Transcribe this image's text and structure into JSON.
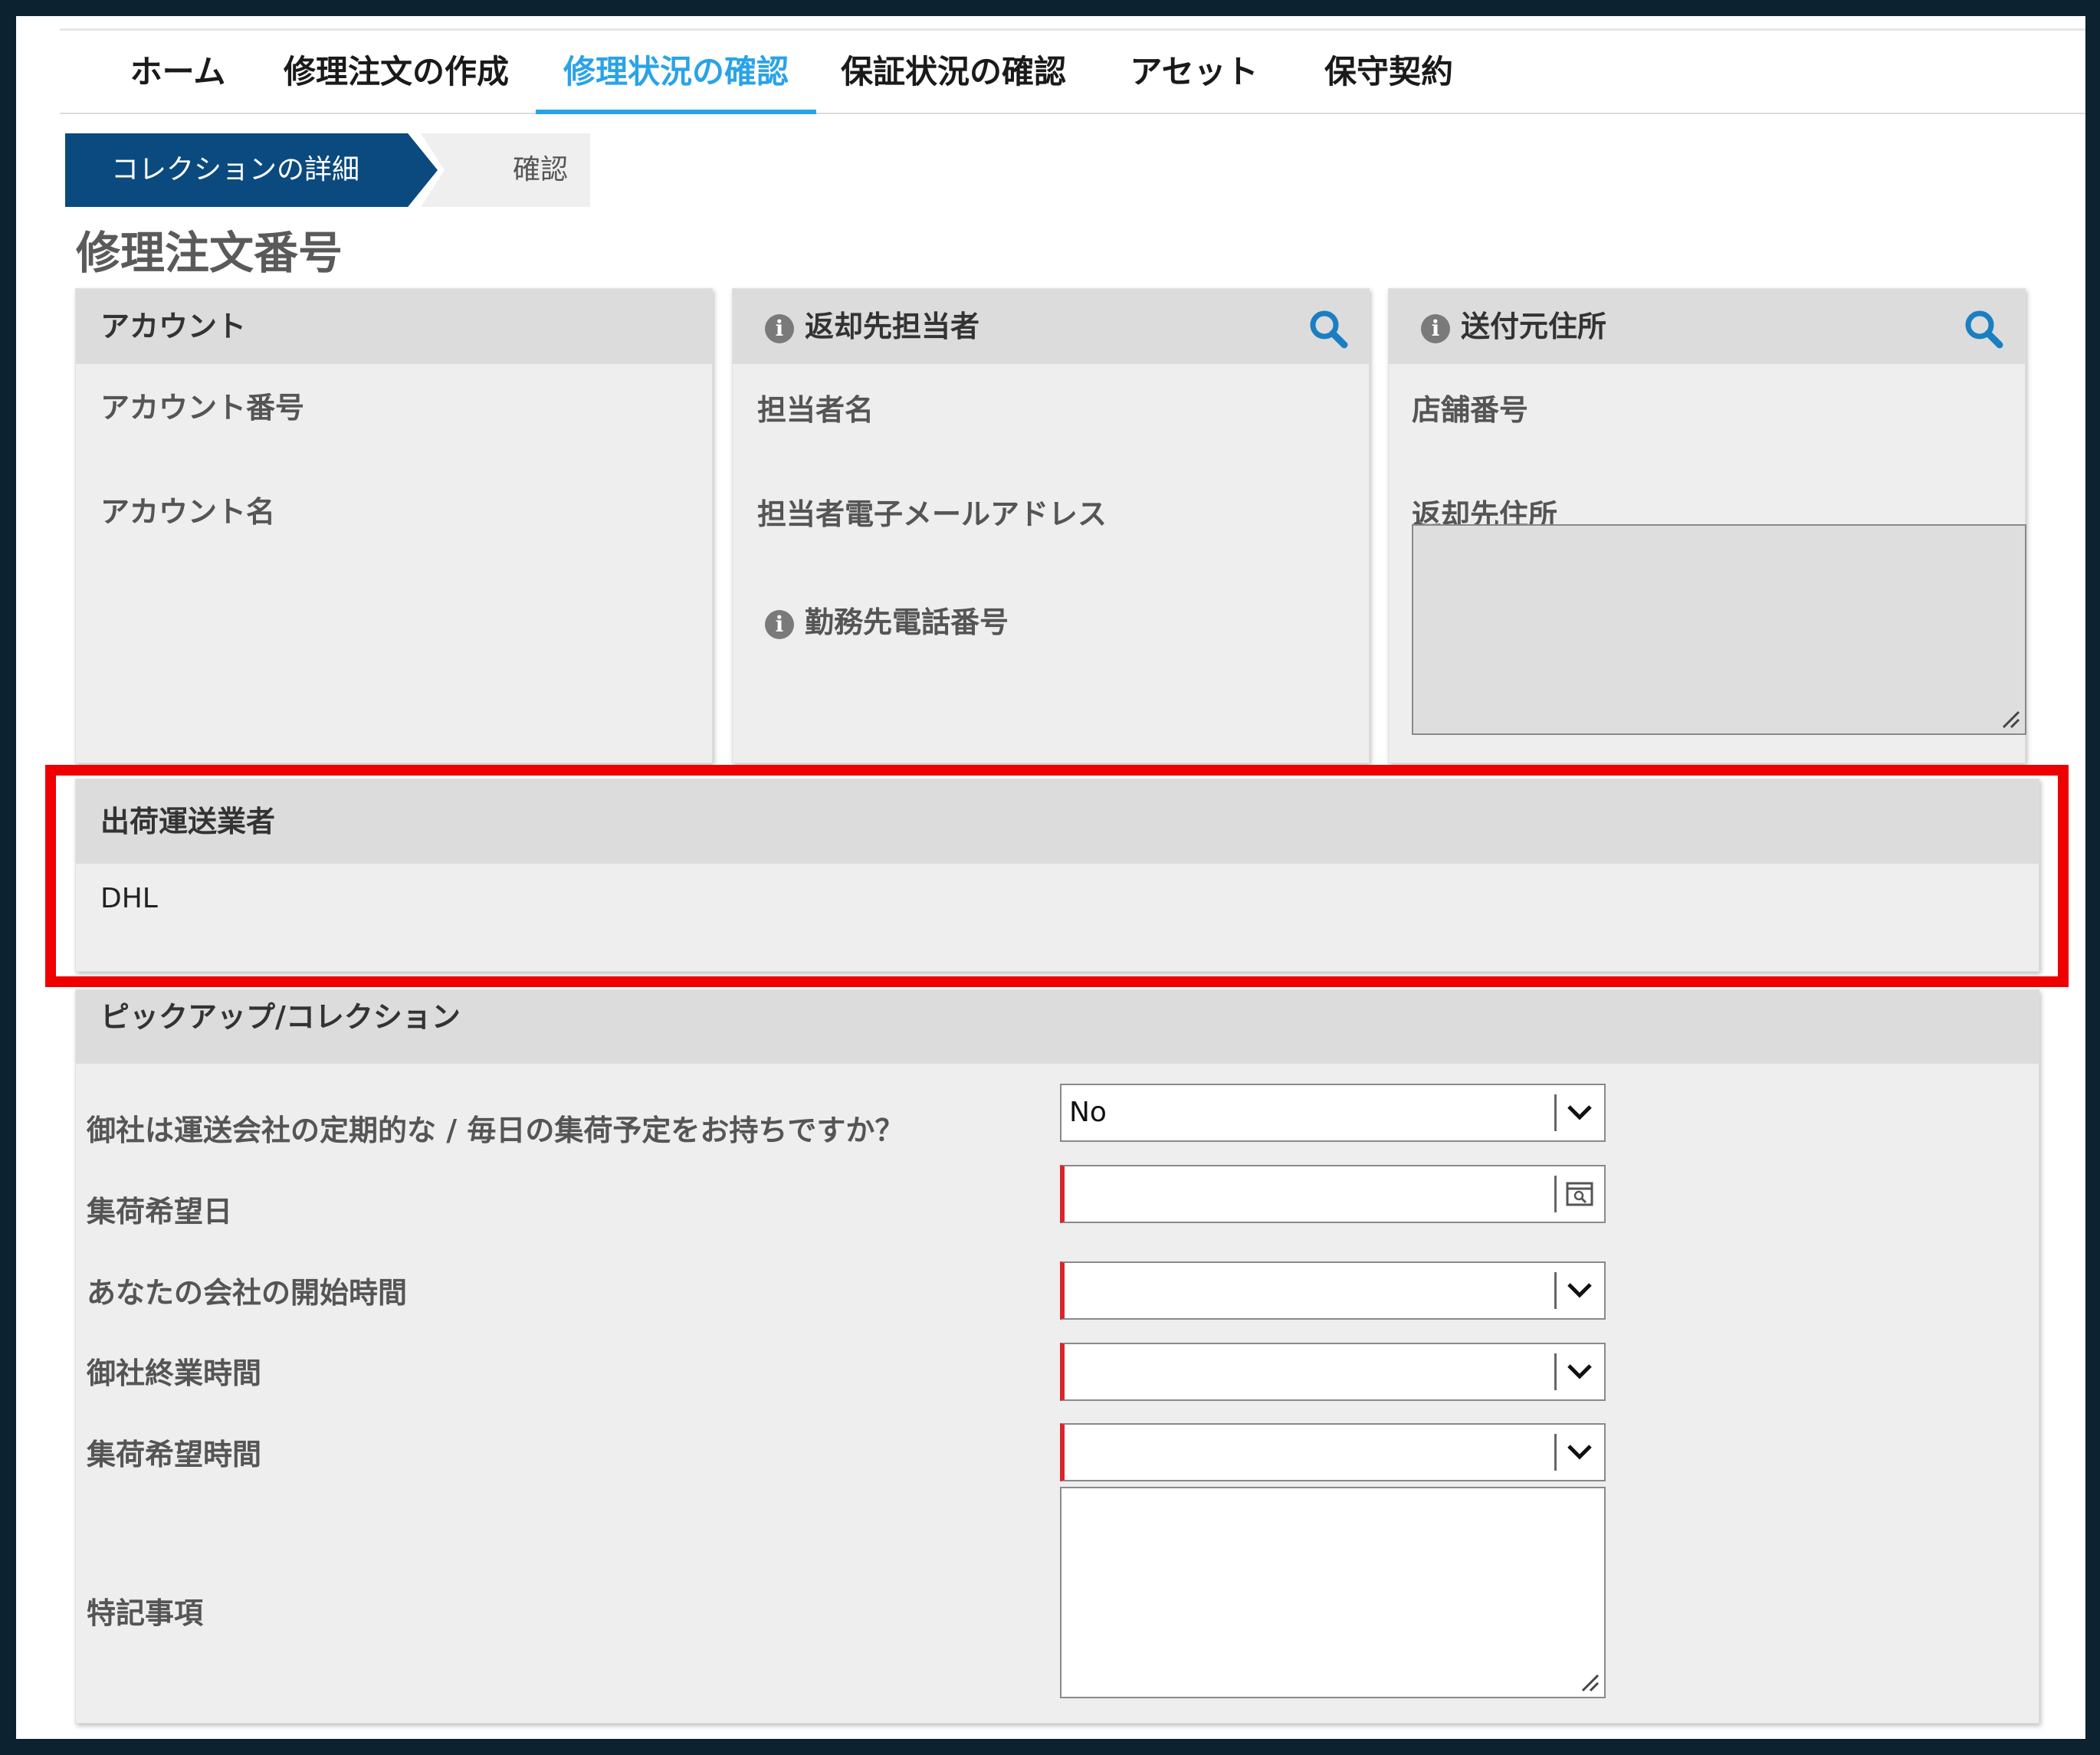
{
  "nav": {
    "items": [
      {
        "label": "ホーム"
      },
      {
        "label": "修理注文の作成"
      },
      {
        "label": "修理状況の確認",
        "active": true
      },
      {
        "label": "保証状況の確認"
      },
      {
        "label": "アセット"
      },
      {
        "label": "保守契約"
      }
    ],
    "active_color": "#29a3e8"
  },
  "steps": {
    "current": "コレクションの詳細",
    "next": "確認"
  },
  "page_title": "修理注文番号",
  "account_card": {
    "title": "アカウント",
    "fields": [
      "アカウント番号",
      "アカウント名"
    ]
  },
  "return_contact_card": {
    "title": "返却先担当者",
    "fields": [
      "担当者名",
      "担当者電子メールアドレス",
      "勤務先電話番号"
    ]
  },
  "ship_from_card": {
    "title": "送付元住所",
    "fields": [
      "店舗番号",
      "返却先住所"
    ]
  },
  "carrier_card": {
    "title": "出荷運送業者",
    "value": "DHL"
  },
  "pickup_card": {
    "title": "ピックアップ/コレクション",
    "fields": {
      "scheduled_pickup": {
        "label": "御社は運送会社の定期的な / 毎日の集荷予定をお持ちですか？",
        "value": "No"
      },
      "pickup_date": {
        "label": "集荷希望日",
        "value": ""
      },
      "open_time": {
        "label": "あなたの会社の開始時間",
        "value": ""
      },
      "close_time": {
        "label": "御社終業時間",
        "value": ""
      },
      "pickup_time": {
        "label": "集荷希望時間",
        "value": ""
      },
      "notes": {
        "label": "特記事項",
        "value": ""
      }
    }
  },
  "colors": {
    "step_active": "#0b4a7e",
    "required_marker": "#d9262c",
    "highlight": "#ee0000",
    "search_icon": "#1a7fc2"
  }
}
